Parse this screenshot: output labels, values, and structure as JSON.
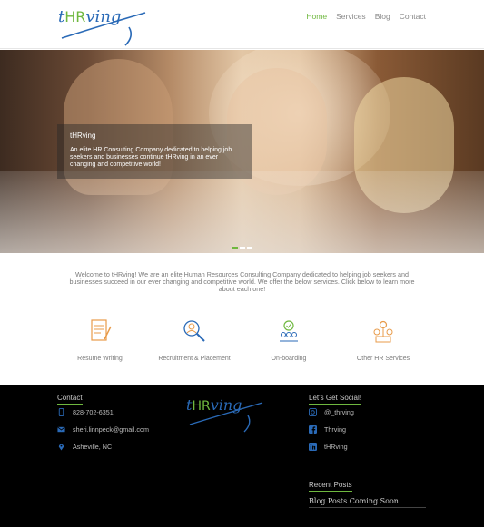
{
  "brand": {
    "logo_text": "tHRving",
    "colors": {
      "accent": "#6fb83f",
      "logo_blue": "#2a6ab7",
      "logo_green": "#6fb83f",
      "footer_bg": "#000000",
      "service_icon": "#e89b4a",
      "service_icon_blue": "#2a6ab7"
    }
  },
  "nav": {
    "items": [
      {
        "label": "Home",
        "active": true
      },
      {
        "label": "Services",
        "active": false
      },
      {
        "label": "Blog",
        "active": false
      },
      {
        "label": "Contact",
        "active": false
      }
    ]
  },
  "hero": {
    "caption_title": "tHRving",
    "caption_text": "An elite HR Consulting Company dedicated to helping job seekers and businesses continue tHRving in an ever changing and competitive world!",
    "slides": 3,
    "active_slide": 1
  },
  "intro": {
    "text": "Welcome to tHRving! We are an elite Human Resources Consulting Company dedicated to helping job seekers and businesses succeed in our ever changing and competitive world. We offer the below services. Click below to learn more about each one!"
  },
  "services": [
    {
      "label": "Resume Writing",
      "icon": "resume-icon"
    },
    {
      "label": "Recruitment & Placement",
      "icon": "recruitment-icon"
    },
    {
      "label": "On-boarding",
      "icon": "onboarding-icon"
    },
    {
      "label": "Other HR Services",
      "icon": "hr-services-icon"
    }
  ],
  "footer": {
    "contact_heading": "Contact",
    "phone": "828-702-6351",
    "email": "sheri.linnpeck@gmail.com",
    "location": "Asheville, NC",
    "social_heading": "Let's Get Social!",
    "instagram": "@_thrving",
    "facebook": "Thrving",
    "linkedin": "tHRving",
    "recent_heading": "Recent Posts",
    "blog_status": "Blog Posts Coming Soon!"
  }
}
